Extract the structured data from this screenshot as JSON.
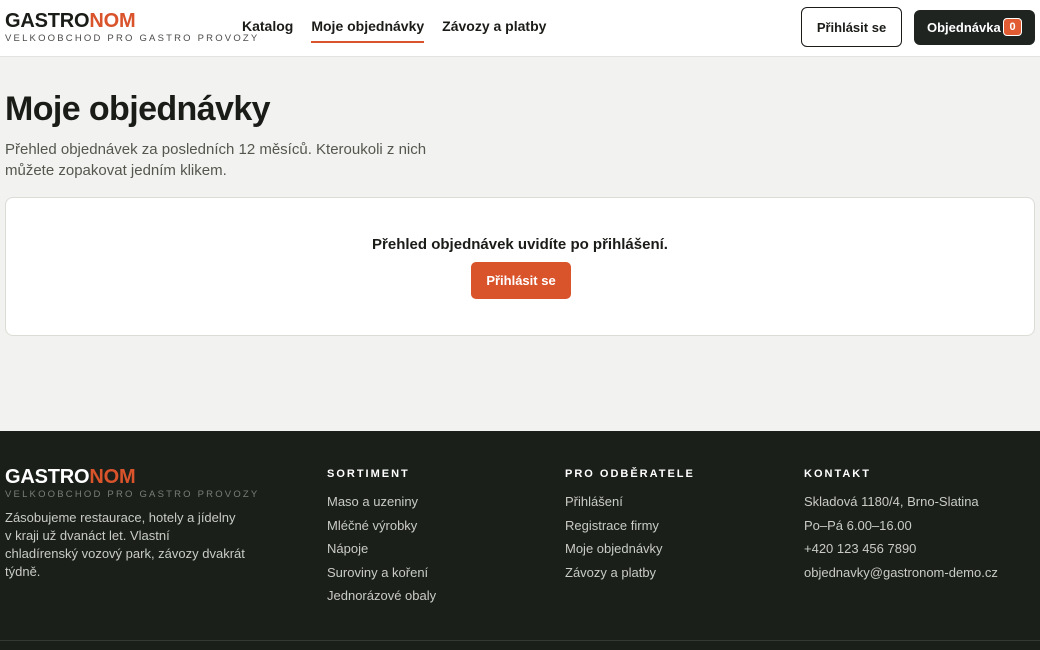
{
  "brand": {
    "name_part1": "GASTRO",
    "name_part2": "NOM",
    "tagline": "VELKOOBCHOD PRO GASTRO PROVOZY"
  },
  "nav": {
    "items": [
      {
        "label": "Katalog"
      },
      {
        "label": "Moje objednávky"
      },
      {
        "label": "Závozy a platby"
      }
    ]
  },
  "header": {
    "login_label": "Přihlásit se",
    "order_label": "Objednávka",
    "order_count": "0"
  },
  "main": {
    "title": "Moje objednávky",
    "description": "Přehled objednávek za posledních 12 měsíců. Kteroukoli z nich můžete zopakovat jedním klikem.",
    "login_message": "Přehled objednávek uvidíte po přihlášení.",
    "login_button": "Přihlásit se"
  },
  "footer": {
    "about": "Zásobujeme restaurace, hotely a jídelny v kraji už dvanáct let. Vlastní chladírenský vozový park, závozy dvakrát týdně.",
    "columns": [
      {
        "title": "SORTIMENT",
        "links": [
          "Maso a uzeniny",
          "Mléčné výrobky",
          "Nápoje",
          "Suroviny a koření",
          "Jednorázové obaly"
        ]
      },
      {
        "title": "PRO ODBĚRATELE",
        "links": [
          "Přihlášení",
          "Registrace firmy",
          "Moje objednávky",
          "Závozy a platby"
        ]
      },
      {
        "title": "KONTAKT",
        "links": [
          "Skladová 1180/4, Brno-Slatina",
          "Po–Pá 6.00–16.00",
          "+420 123 456 7890",
          "objednavky@gastronom-demo.cz"
        ]
      }
    ]
  },
  "colors": {
    "accent": "#d9532b",
    "dark": "#1a1f1a",
    "background": "#f2f2f0"
  }
}
